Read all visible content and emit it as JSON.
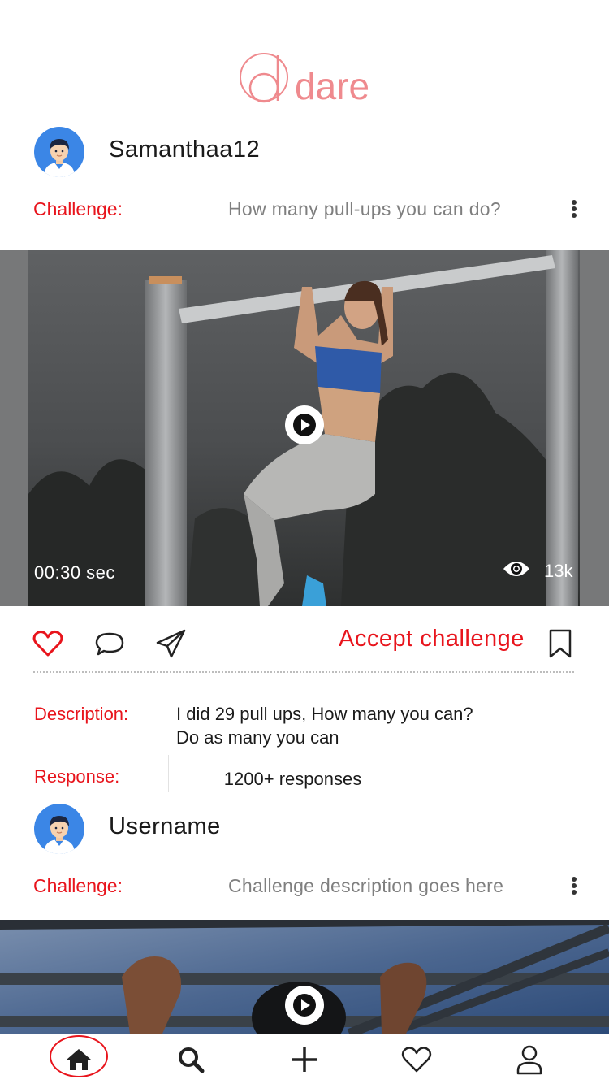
{
  "app": {
    "logo_text": "dare"
  },
  "posts": [
    {
      "username": "Samanthaa12",
      "challenge_label": "Challenge:",
      "challenge_text": "How many pull-ups you can do?",
      "duration": "00:30 sec",
      "views": "13k",
      "accept_label": "Accept challenge",
      "description_label": "Description:",
      "description_line1": "I did 29 pull ups, How many you can?",
      "description_line2": "Do as many you can",
      "response_label": "Response:",
      "response_text": "1200+ responses"
    },
    {
      "username": "Username",
      "challenge_label": "Challenge:",
      "challenge_text": "Challenge description goes here"
    }
  ],
  "icons": {
    "avatar": "user-avatar-icon",
    "more": "more-vertical-icon",
    "play": "play-icon",
    "views": "eye-icon",
    "like": "heart-icon",
    "comment": "comment-icon",
    "share": "send-icon",
    "bookmark": "bookmark-icon"
  },
  "bottom_nav": {
    "items": [
      "home-icon",
      "search-icon",
      "add-icon",
      "heart-icon",
      "profile-icon"
    ],
    "active": "home-icon"
  },
  "colors": {
    "accent": "#e8141c",
    "logo": "#ef8a8e",
    "muted_text": "#7f7f7f",
    "avatar_bg": "#3b86e6"
  }
}
